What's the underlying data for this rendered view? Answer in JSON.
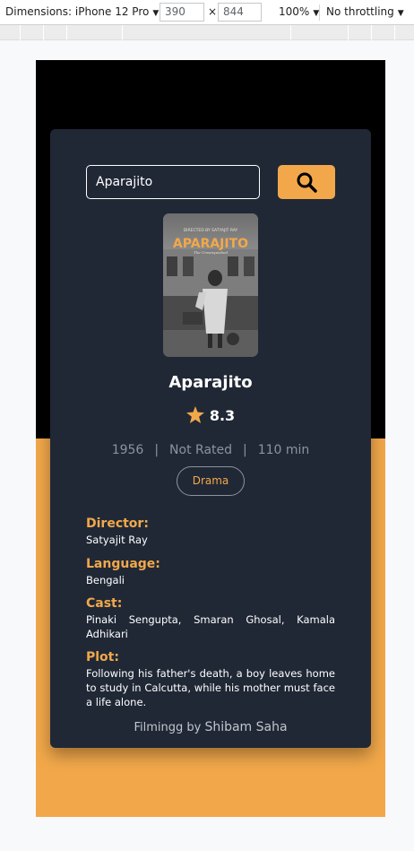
{
  "devtools": {
    "dimensions_label": "Dimensions: iPhone 12 Pro",
    "width_value": "390",
    "times": "×",
    "height_value": "844",
    "zoom": "100%",
    "throttling": "No throttling"
  },
  "search": {
    "value": "Aparajito",
    "button_icon": "search-icon"
  },
  "poster": {
    "credit_text": "DIRECTED BY SATYAJIT RAY",
    "title_text": "APARAJITO",
    "subtitle_text": "The Unvanquished"
  },
  "movie": {
    "title": "Aparajito",
    "rating": "8.3",
    "year": "1956",
    "rated": "Not Rated",
    "runtime": "110 min",
    "separator": "|",
    "genre": "Drama"
  },
  "details": {
    "director_label": "Director:",
    "director": "Satyajit Ray",
    "language_label": "Language:",
    "language": "Bengali",
    "cast_label": "Cast:",
    "cast": "Pinaki Sengupta, Smaran Ghosal, Kamala Adhikari",
    "plot_label": "Plot:",
    "plot": "Following his father's death, a boy leaves home to study in Calcutta, while his mother must face a life alone."
  },
  "footer": {
    "prefix": "Filmingg by",
    "author": "Shibam Saha"
  },
  "colors": {
    "accent": "#f2a84a",
    "card": "#202836",
    "top_background": "#000000"
  }
}
